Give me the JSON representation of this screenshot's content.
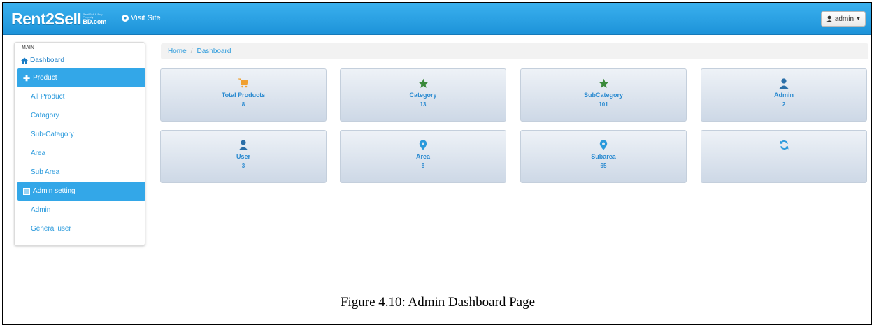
{
  "navbar": {
    "brand_main": "Rent2Sell",
    "brand_tagline": "Rent Sell & Buy\nProperty",
    "brand_domain": "BD.com",
    "visit_site": "Visit Site",
    "admin_menu": "admin"
  },
  "sidebar": {
    "header": "MAIN",
    "dashboard": "Dashboard",
    "product_section": "Product",
    "product_items": [
      "All Product",
      "Catagory",
      "Sub-Catagory",
      "Area",
      "Sub Area"
    ],
    "admin_section": "Admin setting",
    "admin_items": [
      "Admin",
      "General user"
    ]
  },
  "breadcrumb": {
    "home": "Home",
    "separator": "/",
    "current": "Dashboard"
  },
  "tiles": [
    {
      "label": "Total Products",
      "value": "8",
      "icon": "cart-icon",
      "color": "#f0a030"
    },
    {
      "label": "Category",
      "value": "13",
      "icon": "star-icon",
      "color": "#3a8a3a"
    },
    {
      "label": "SubCategory",
      "value": "101",
      "icon": "star-icon",
      "color": "#3a8a3a"
    },
    {
      "label": "Admin",
      "value": "2",
      "icon": "user-icon",
      "color": "#2b6fa8"
    },
    {
      "label": "User",
      "value": "3",
      "icon": "user-icon",
      "color": "#2b6fa8"
    },
    {
      "label": "Area",
      "value": "8",
      "icon": "map-marker-icon",
      "color": "#2a9adc"
    },
    {
      "label": "Subarea",
      "value": "65",
      "icon": "map-marker-icon",
      "color": "#2a9adc"
    },
    {
      "label": "",
      "value": "",
      "icon": "refresh-icon",
      "color": "#2a9adc"
    }
  ],
  "caption": "Figure 4.10: Admin Dashboard Page"
}
